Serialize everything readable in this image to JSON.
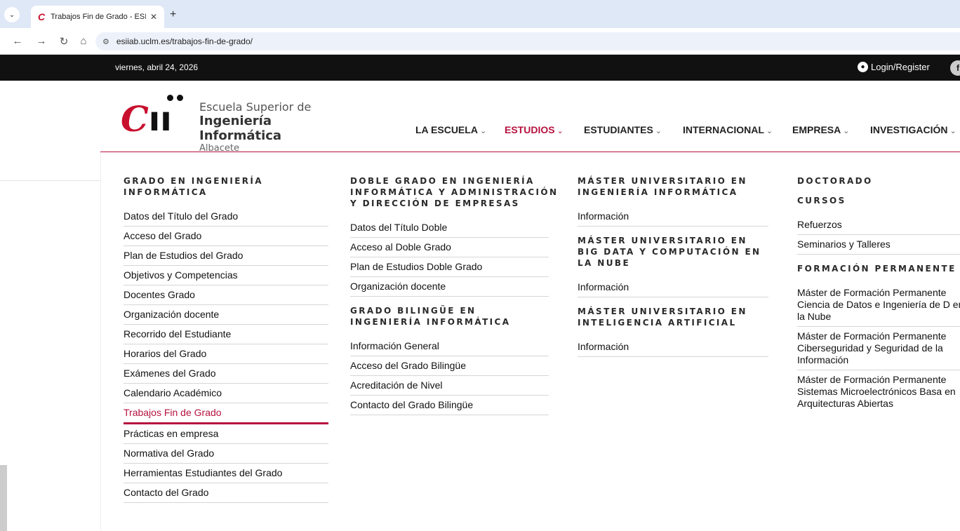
{
  "browser": {
    "tab_title": "Trabajos Fin de Grado - ESIIAB",
    "url": "esiiab.uclm.es/trabajos-fin-de-grado/"
  },
  "topbar": {
    "date": "viernes, abril 24, 2026",
    "login": "Login/Register"
  },
  "logo": {
    "line1": "Escuela Superior de",
    "line2": "Ingeniería Informática",
    "line3": "Albacete"
  },
  "nav": {
    "items": [
      {
        "label": "LA ESCUELA"
      },
      {
        "label": "ESTUDIOS"
      },
      {
        "label": "ESTUDIANTES"
      },
      {
        "label": "INTERNACIONAL"
      },
      {
        "label": "EMPRESA"
      },
      {
        "label": "INVESTIGACIÓN"
      }
    ],
    "active": "ESTUDIOS"
  },
  "mega": {
    "col1": {
      "heading": "GRADO EN INGENIERÍA INFORMÁTICA",
      "links": [
        "Datos del Título del Grado",
        "Acceso del Grado",
        "Plan de Estudios del Grado",
        "Objetivos y Competencias",
        "Docentes Grado",
        "Organización docente",
        "Recorrido del Estudiante",
        "Horarios del Grado",
        "Exámenes del Grado",
        "Calendario Académico",
        "Trabajos Fin de Grado",
        "Prácticas en empresa",
        "Normativa del Grado",
        "Herramientas Estudiantes del Grado",
        "Contacto del Grado"
      ]
    },
    "col2": {
      "heading1": "DOBLE GRADO EN INGENIERÍA INFORMÁTICA Y ADMINISTRACIÓN Y DIRECCIÓN DE EMPRESAS",
      "links1": [
        "Datos del Título Doble",
        "Acceso al Doble Grado",
        "Plan de Estudios Doble Grado",
        "Organización docente"
      ],
      "heading2": "GRADO BILINGÜE EN INGENIERÍA INFORMÁTICA",
      "links2": [
        "Información General",
        "Acceso del Grado Bilingüe",
        "Acreditación de Nivel",
        "Contacto del Grado Bilingüe"
      ]
    },
    "col3": {
      "heading1": "MÁSTER UNIVERSITARIO EN INGENIERÍA INFORMÁTICA",
      "link1": "Información",
      "heading2": "MÁSTER UNIVERSITARIO EN BIG DATA Y COMPUTACIÓN EN LA NUBE",
      "link2": "Información",
      "heading3": "MÁSTER UNIVERSITARIO EN INTELIGENCIA ARTIFICIAL",
      "link3": "Información"
    },
    "col4": {
      "heading1": "DOCTORADO",
      "heading2": "CURSOS",
      "links2": [
        "Refuerzos",
        "Seminarios y Talleres"
      ],
      "heading3": "FORMACIÓN PERMANENTE",
      "links3": [
        "Máster de Formación Permanente Ciencia de Datos e Ingeniería de D en la Nube",
        "Máster de Formación Permanente Ciberseguridad y Seguridad de la Información",
        "Máster de Formación Permanente Sistemas Microelectrónicos Basa en Arquitecturas Abiertas"
      ]
    }
  },
  "colors": {
    "accent": "#b5123f",
    "topbar_bg": "#111111",
    "tabstrip_bg": "#dfe8f6"
  }
}
